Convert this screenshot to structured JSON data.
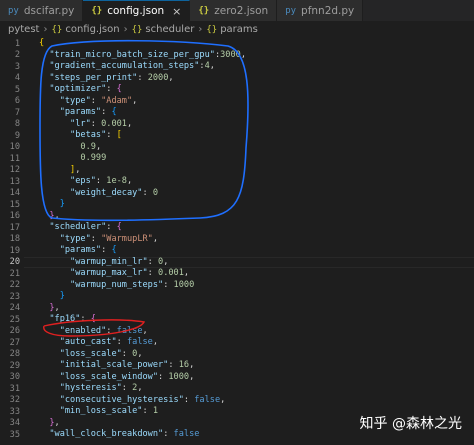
{
  "tabs": [
    {
      "icon": "py",
      "label": "dscifar.py",
      "active": false
    },
    {
      "icon": "{}",
      "label": "config.json",
      "active": true,
      "close": "×"
    },
    {
      "icon": "{}",
      "label": "zero2.json",
      "active": false
    },
    {
      "icon": "py",
      "label": "pfnn2d.py",
      "active": false
    }
  ],
  "breadcrumb": {
    "root": "pytest",
    "file_icon": "{}",
    "file": "config.json",
    "item1_icon": "{}",
    "item1": "scheduler",
    "item2_icon": "{}",
    "item2": "params"
  },
  "editor": {
    "current_line": 20,
    "line_numbers": [
      "1",
      "2",
      "3",
      "4",
      "5",
      "6",
      "7",
      "8",
      "9",
      "10",
      "11",
      "12",
      "13",
      "14",
      "15",
      "16",
      "17",
      "18",
      "19",
      "20",
      "21",
      "22",
      "23",
      "24",
      "25",
      "26",
      "27",
      "28",
      "29",
      "30",
      "31",
      "32",
      "33",
      "34",
      "35"
    ]
  },
  "code": {
    "l1": "{",
    "l2_key": "\"train_micro_batch_size_per_gpu\"",
    "l2_val": "3000",
    "l3_key": "\"gradient_accumulation_steps\"",
    "l3_val": "4",
    "l4_key": "\"steps_per_print\"",
    "l4_val": "2000",
    "l5_key": "\"optimizer\"",
    "l6_key": "\"type\"",
    "l6_val": "\"Adam\"",
    "l7_key": "\"params\"",
    "l8_key": "\"lr\"",
    "l8_val": "0.001",
    "l9_key": "\"betas\"",
    "l10_val": "0.9",
    "l11_val": "0.999",
    "l13_key": "\"eps\"",
    "l13_val": "1e-8",
    "l14_key": "\"weight_decay\"",
    "l14_val": "0",
    "l17_key": "\"scheduler\"",
    "l18_key": "\"type\"",
    "l18_val": "\"WarmupLR\"",
    "l19_key": "\"params\"",
    "l20_key": "\"warmup_min_lr\"",
    "l20_val": "0",
    "l21_key": "\"warmup_max_lr\"",
    "l21_val": "0.001",
    "l22_key": "\"warmup_num_steps\"",
    "l22_val": "1000",
    "l25_key": "\"fp16\"",
    "l26_key": "\"enabled\"",
    "l26_val": "false",
    "l27_key": "\"auto_cast\"",
    "l27_val": "false",
    "l28_key": "\"loss_scale\"",
    "l28_val": "0",
    "l29_key": "\"initial_scale_power\"",
    "l29_val": "16",
    "l30_key": "\"loss_scale_window\"",
    "l30_val": "1000",
    "l31_key": "\"hysteresis\"",
    "l31_val": "2",
    "l32_key": "\"consecutive_hysteresis\"",
    "l32_val": "false",
    "l33_key": "\"min_loss_scale\"",
    "l33_val": "1",
    "l35_key": "\"wall_clock_breakdown\"",
    "l35_val": "false"
  },
  "watermark": {
    "text": "知乎 @森林之光"
  },
  "colors": {
    "annotation_blue": "#1f6fff",
    "annotation_red": "#e02020",
    "editor_bg": "#1e1e1e"
  }
}
